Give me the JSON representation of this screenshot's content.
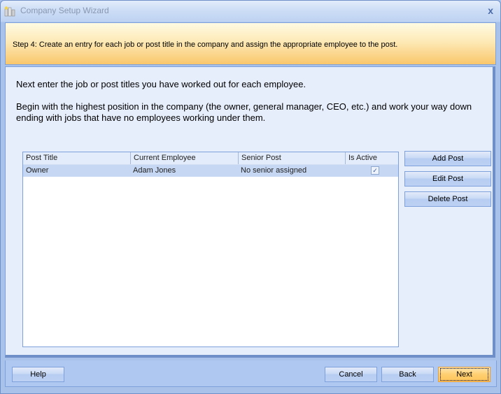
{
  "window": {
    "title": "Company Setup Wizard",
    "close_glyph": "x"
  },
  "banner": {
    "text": "Step 4: Create an entry for each job or post title in the company and assign the appropriate employee to the post."
  },
  "intro": {
    "line1": "Next enter the job or post titles you have worked out for each employee.",
    "line2": "Begin with the highest position in the company (the owner, general manager, CEO, etc.) and work your way down ending with jobs that have no employees working under them."
  },
  "grid": {
    "columns": [
      "Post Title",
      "Current Employee",
      "Senior Post",
      "Is Active"
    ],
    "rows": [
      {
        "post_title": "Owner",
        "current_employee": "Adam Jones",
        "senior_post": "No senior assigned",
        "is_active": true,
        "is_active_glyph": "✓"
      }
    ]
  },
  "side_buttons": {
    "add": "Add Post",
    "edit": "Edit Post",
    "delete": "Delete Post"
  },
  "footer": {
    "help": "Help",
    "cancel": "Cancel",
    "back": "Back",
    "next": "Next"
  }
}
